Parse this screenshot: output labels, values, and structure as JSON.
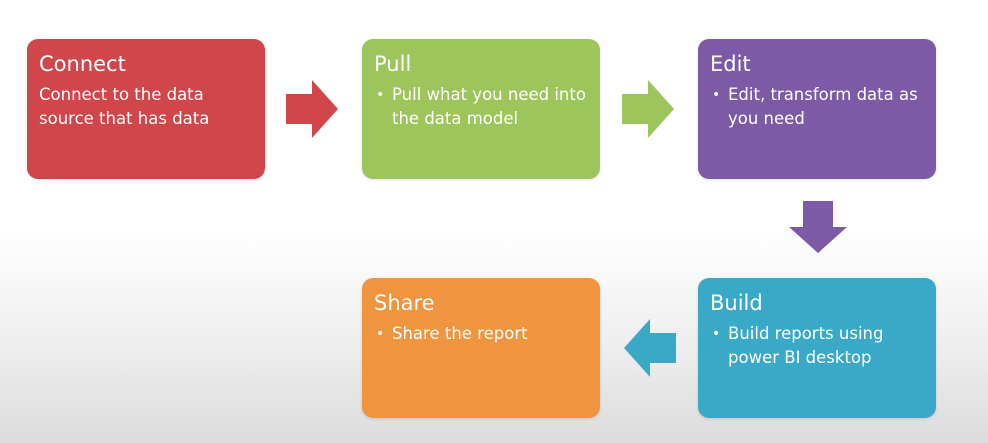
{
  "steps": {
    "connect": {
      "title": "Connect",
      "text": "Connect to the data source that has data",
      "color": "#d0464a"
    },
    "pull": {
      "title": "Pull",
      "text": "Pull what you need into the data model",
      "color": "#9cc55c"
    },
    "edit": {
      "title": "Edit",
      "text": "Edit, transform data as you need",
      "color": "#7c5aa6"
    },
    "build": {
      "title": "Build",
      "text": "Build reports using power BI desktop",
      "color": "#3aa9c7"
    },
    "share": {
      "title": "Share",
      "text": "Share the report",
      "color": "#ef953f"
    }
  },
  "arrows": {
    "connect_to_pull": {
      "color": "#d0464a"
    },
    "pull_to_edit": {
      "color": "#9cc55c"
    },
    "edit_to_build": {
      "color": "#7c5aa6"
    },
    "build_to_share": {
      "color": "#3aa9c7"
    }
  }
}
